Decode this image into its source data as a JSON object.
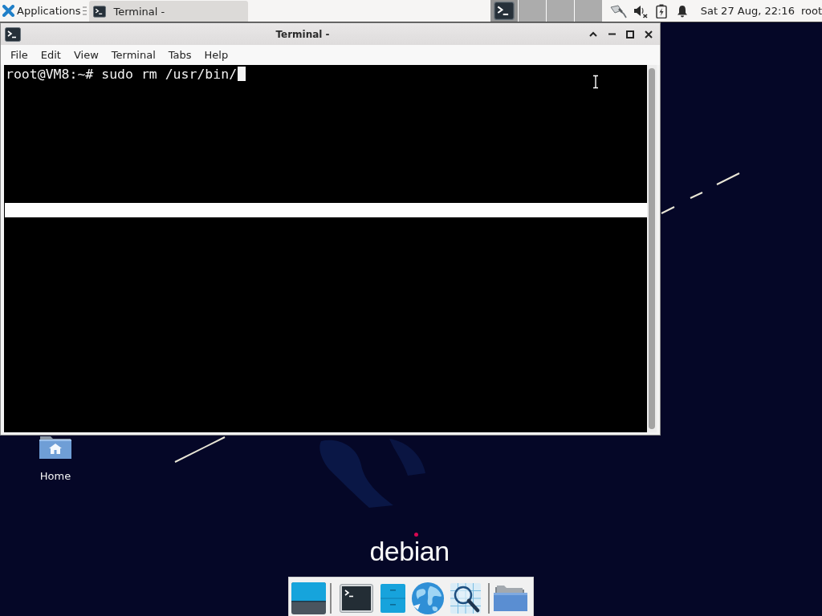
{
  "top_panel": {
    "applications_menu": {
      "label": "Applications"
    },
    "tasks": [
      {
        "label": "Terminal -",
        "selected": true
      }
    ],
    "workspaces": [
      {
        "selected": true,
        "has_window": true
      },
      {
        "selected": false,
        "has_window": false
      },
      {
        "selected": false,
        "has_window": false
      },
      {
        "selected": false,
        "has_window": false
      }
    ],
    "clock": "Sat 27 Aug, 22:16",
    "user": "root"
  },
  "terminal_window": {
    "title": "Terminal -",
    "menu": [
      "File",
      "Edit",
      "View",
      "Terminal",
      "Tabs",
      "Help"
    ],
    "lines": [
      "root@VM8:~# sudo rm /usr/bin/"
    ],
    "cursor_visible": true
  },
  "desktop": {
    "icons": [
      {
        "label": "Home"
      }
    ],
    "logo": "debian"
  },
  "dock": {
    "items": [
      {
        "kind": "show-desktop"
      },
      {
        "kind": "separator"
      },
      {
        "kind": "terminal"
      },
      {
        "kind": "file-manager"
      },
      {
        "kind": "web-browser"
      },
      {
        "kind": "app-finder"
      },
      {
        "kind": "separator"
      },
      {
        "kind": "folder"
      }
    ]
  }
}
